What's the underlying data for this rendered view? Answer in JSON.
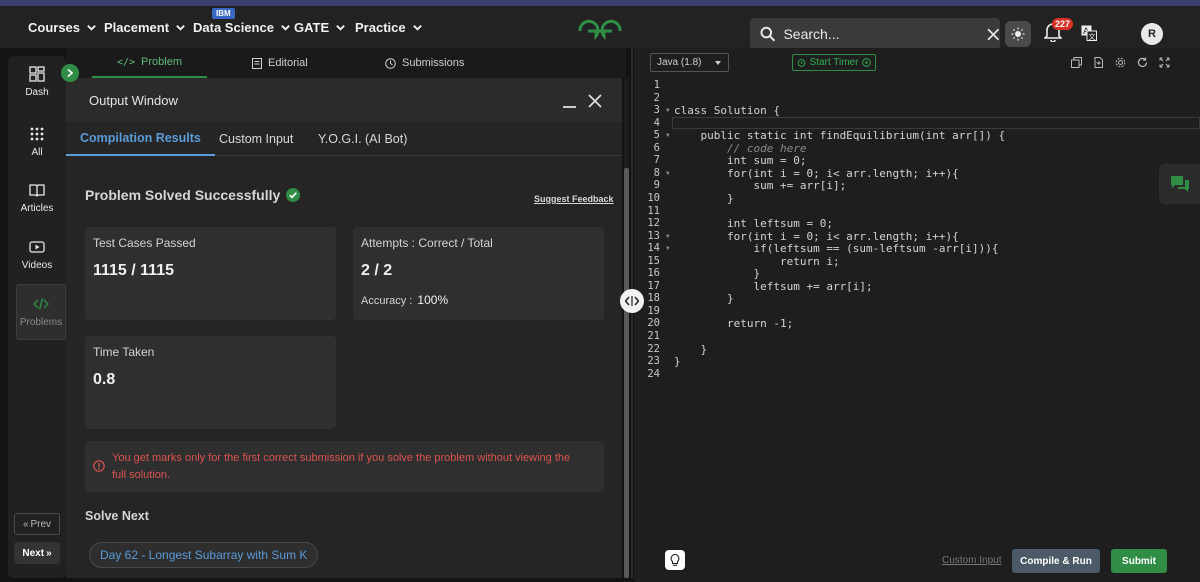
{
  "nav": {
    "items": [
      {
        "label": "Courses"
      },
      {
        "label": "Placement"
      },
      {
        "label": "Data Science"
      },
      {
        "label": "GATE"
      },
      {
        "label": "Practice"
      }
    ],
    "ibm_badge": "IBM",
    "search_placeholder": "Search...",
    "notification_count": "227",
    "avatar_initial": "R",
    "brand_color": "#2f8d46"
  },
  "sidebar": {
    "items": [
      {
        "label": "Dash",
        "icon": "dashboard-icon"
      },
      {
        "label": "All",
        "icon": "grid-icon"
      },
      {
        "label": "Articles",
        "icon": "book-icon"
      },
      {
        "label": "Videos",
        "icon": "video-icon"
      },
      {
        "label": "Problems",
        "icon": "code-icon"
      }
    ],
    "prev_label": "Prev",
    "next_label": "Next"
  },
  "problem_tabs": [
    {
      "label": "Problem"
    },
    {
      "label": "Editorial"
    },
    {
      "label": "Submissions"
    }
  ],
  "output": {
    "title": "Output Window",
    "tabs": [
      {
        "label": "Compilation Results"
      },
      {
        "label": "Custom Input"
      },
      {
        "label": "Y.O.G.I. (AI Bot)"
      }
    ],
    "status": "Problem Solved Successfully",
    "feedback_link": "Suggest Feedback",
    "cards": {
      "tests_label": "Test Cases Passed",
      "tests_value": "1115 / 1115",
      "attempts_label": "Attempts : Correct / Total",
      "attempts_value": "2 / 2",
      "accuracy_label": "Accuracy :",
      "accuracy_value": "100%",
      "time_label": "Time Taken",
      "time_value": "0.8"
    },
    "notice": "You get marks only for the first correct submission if you solve the problem without viewing the full solution.",
    "solve_next_label": "Solve Next",
    "next_problem": "Day 62 - Longest Subarray with Sum K"
  },
  "editor": {
    "language": "Java (1.8)",
    "timer_label": "Start Timer",
    "lines": [
      "",
      "",
      "class Solution {",
      "",
      "    public static int findEquilibrium(int arr[]) {",
      "        // code here",
      "        int sum = 0;",
      "        for(int i = 0; i< arr.length; i++){",
      "            sum += arr[i];",
      "        }",
      "",
      "        int leftsum = 0;",
      "        for(int i = 0; i< arr.length; i++){",
      "            if(leftsum == (sum-leftsum -arr[i])){",
      "                return i;",
      "            }",
      "            leftsum += arr[i];",
      "        }",
      "",
      "        return -1;",
      "",
      "    }",
      "}",
      ""
    ],
    "line_numbers": [
      "1",
      "2",
      "3",
      "4",
      "5",
      "6",
      "7",
      "8",
      "9",
      "10",
      "11",
      "12",
      "13",
      "14",
      "15",
      "16",
      "17",
      "18",
      "19",
      "20",
      "21",
      "22",
      "23",
      "24"
    ],
    "custom_input_link": "Custom Input",
    "compile_label": "Compile & Run",
    "submit_label": "Submit"
  }
}
